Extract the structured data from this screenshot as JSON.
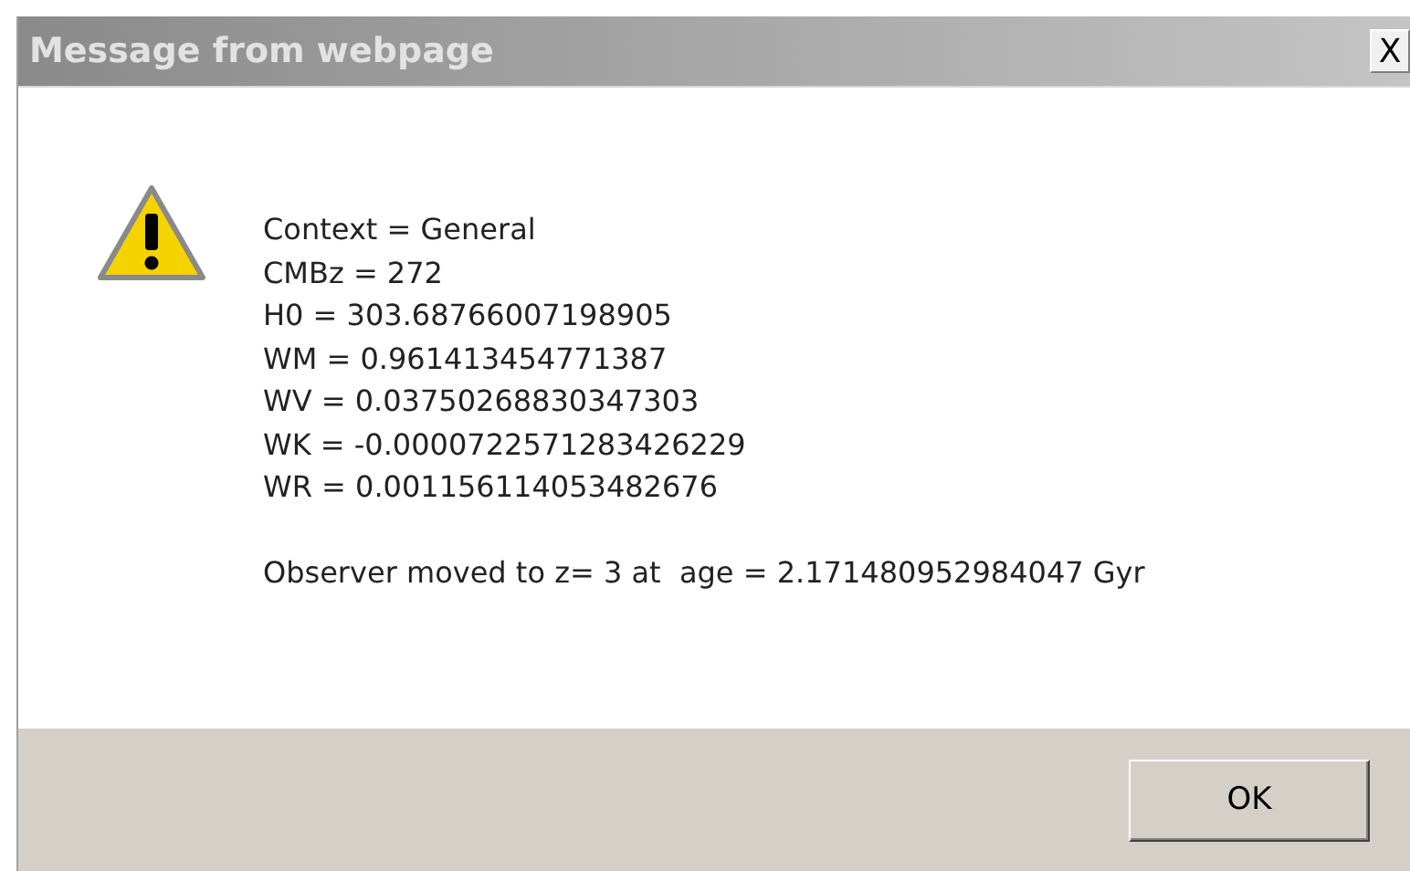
{
  "window": {
    "title": "Message from webpage",
    "close": "X"
  },
  "message": {
    "lines": [
      "Context = General",
      "CMBz = 272",
      "H0 = 303.68766007198905",
      "WM = 0.961413454771387",
      "WV = 0.03750268830347303",
      "WK = -0.0000722571283426229",
      "WR = 0.001156114053482676"
    ],
    "footer_line": "Observer moved to z= 3 at  age = 2.171480952984047 Gyr"
  },
  "buttons": [
    "OK"
  ]
}
